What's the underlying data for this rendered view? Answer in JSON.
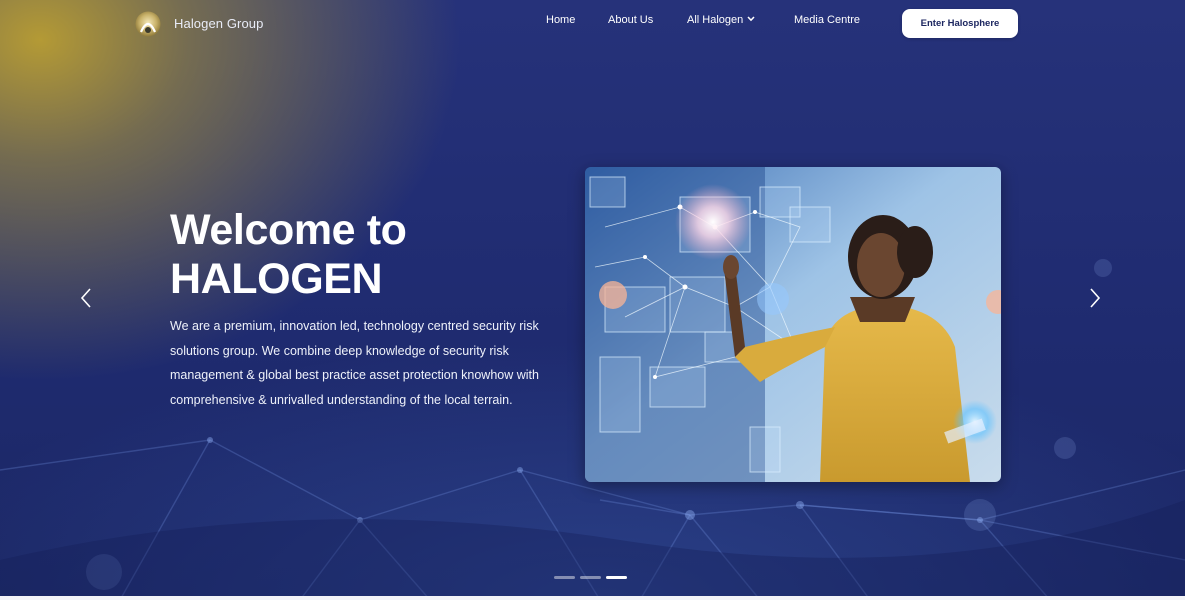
{
  "header": {
    "brand_name": "Halogen Group",
    "logo_icon": "halogen-logo-icon",
    "nav": [
      {
        "label": "Home"
      },
      {
        "label": "About Us"
      },
      {
        "label": "All Halogen",
        "icon": "chevron-down-icon"
      },
      {
        "label": "Media Centre"
      }
    ],
    "cta_label": "Enter Halosphere"
  },
  "hero": {
    "title_line1": "Welcome to",
    "title_line2": "HALOGEN",
    "description": "We are a premium, innovation led, technology centred security risk solutions group. We combine deep knowledge of security risk management & global best practice asset protection knowhow with comprehensive & unrivalled understanding of the local terrain.",
    "image_icon": "woman-touching-holographic-interface-image"
  },
  "carousel": {
    "prev_icon": "chevron-left-icon",
    "next_icon": "chevron-right-icon",
    "slide_count": 3,
    "active_slide": 3
  },
  "colors": {
    "background": "#1e2a6b",
    "accent_gold": "#b49a35",
    "cta_text": "#1c2660",
    "text": "#ffffff"
  }
}
